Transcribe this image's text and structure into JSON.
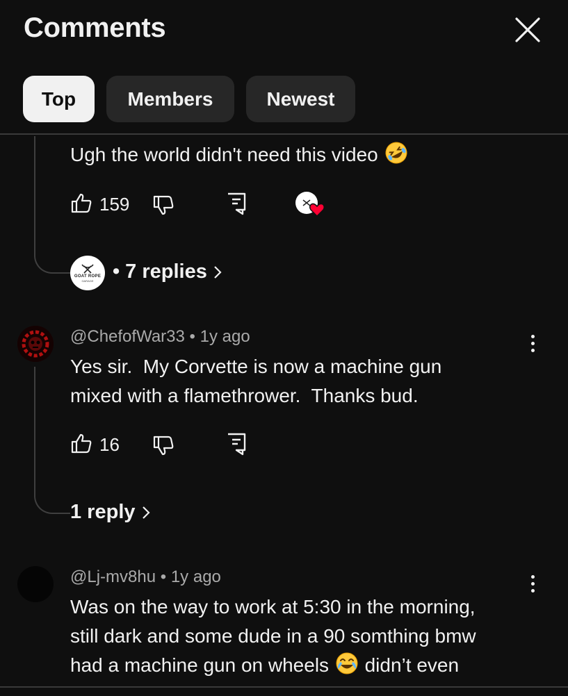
{
  "header": {
    "title": "Comments"
  },
  "tabs": [
    {
      "label": "Top",
      "active": true
    },
    {
      "label": "Members",
      "active": false
    },
    {
      "label": "Newest",
      "active": false
    }
  ],
  "comments": [
    {
      "text": "Ugh the world didn't need this video",
      "emoji": "rolling-on-floor-laughing-emoji",
      "likes": "159",
      "creator_heart": true,
      "replies_label": "7 replies",
      "replies_separator": "•",
      "replier_avatar": {
        "brand": "GOAT ROPE",
        "sub": "GARAGE"
      }
    },
    {
      "author": "@ChefofWar33",
      "separator": "•",
      "time": "1y ago",
      "text_lines": [
        "Yes sir.  My Corvette is now a machine gun",
        "mixed with a flamethrower.  Thanks bud."
      ],
      "likes": "16",
      "replies_label": "1 reply"
    },
    {
      "author": "@Lj-mv8hu",
      "separator": "•",
      "time": "1y ago",
      "text_lines": [
        "Was on the way to work at 5:30 in the morning,",
        "still dark and some dude in a 90 somthing bmw"
      ],
      "line3_before": "had a machine gun on wheels",
      "line3_emoji": "face-with-tears-of-joy-emoji",
      "line3_after": "didn’t even"
    }
  ],
  "colors": {
    "background": "#0f0f0f",
    "text": "#f1f1f1",
    "secondary_text": "#aaaaaa",
    "chip": "#272727",
    "chip_active": "#f1f1f1",
    "heart": "#ff0033"
  }
}
